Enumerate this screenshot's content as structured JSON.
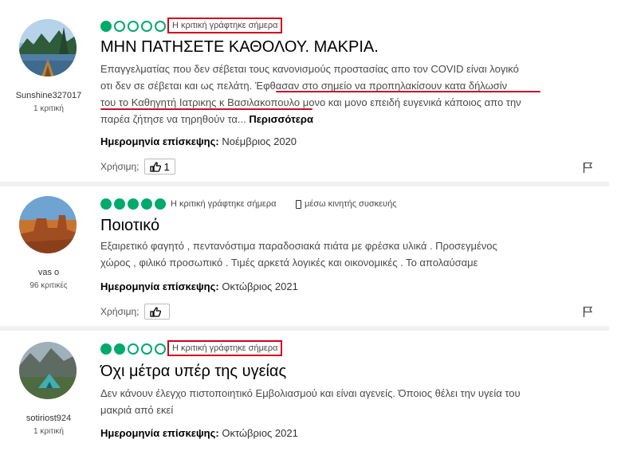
{
  "reviews": [
    {
      "username": "Sunshine327017",
      "count": "1 κριτική",
      "rating": 1,
      "written": "Η κριτική γράφτηκε σήμερα",
      "title": "ΜΗΝ ΠΑΤΗΣΕΤΕ ΚΑΘΟΛΟΥ. ΜΑΚΡΙΑ.",
      "body_lines": [
        "Επαγγελματίας που δεν σέβεται τους κανονισμούς προστασίας απο τον COVID είναι λογικό",
        "οτι δεν σε σέβεται και ως πελάτη. Έφθασαν στο σημείο να προπηλακίσουν κατα δήλωσίν",
        "του το Καθηγητή Ιατρικης κ Βασιλακοπουλο μονο και μονο επειδή ευγενικά κάποιος απο την",
        "παρέα ζήτησε να τηρηθούν τα..."
      ],
      "more": "Περισσότερα",
      "visit_label": "Ημερομηνία επίσκεψης:",
      "visit_date": "Νοέμβριος 2020",
      "helpful_label": "Χρήσιμη;",
      "helpful_count": "1"
    },
    {
      "username": "vas o",
      "count": "96 κριτικές",
      "rating": 5,
      "written": "Η κριτική γράφτηκε σήμερα",
      "device": "μέσω κινητής συσκευής",
      "title": "Ποιοτικό",
      "body_lines": [
        "Εξαιρετικό φαγητό , πεντανόστιμα παραδοσιακά πιάτα με φρέσκα υλικά . Προσεγμένος",
        "χώρος , φιλικό προσωπικό . Τιμές αρκετά λογικές και οικονομικές . Το απολαύσαμε"
      ],
      "visit_label": "Ημερομηνία επίσκεψης:",
      "visit_date": "Οκτώβριος 2021",
      "helpful_label": "Χρήσιμη;",
      "helpful_count": ""
    },
    {
      "username": "sotiriost924",
      "count": "1 κριτική",
      "rating": 2,
      "written": "Η κριτική γράφτηκε σήμερα",
      "title": "Όχι μέτρα υπέρ της υγείας",
      "body_lines": [
        "Δεν κάνουν έλεγχο πιστοποιητικό Εμβολιασμού και είναι αγενείς. Όποιος θέλει την υγεία του",
        "μακριά από εκεί"
      ],
      "visit_label": "Ημερομηνία επίσκεψης:",
      "visit_date": "Οκτώβριος 2021"
    }
  ],
  "colors": {
    "bubble": "#00aa6c",
    "highlight": "#d0021b",
    "underline": "#c8102e"
  },
  "icons": {
    "thumb": "thumbs-up-icon",
    "flag": "flag-icon",
    "device": "mobile-phone-icon"
  }
}
